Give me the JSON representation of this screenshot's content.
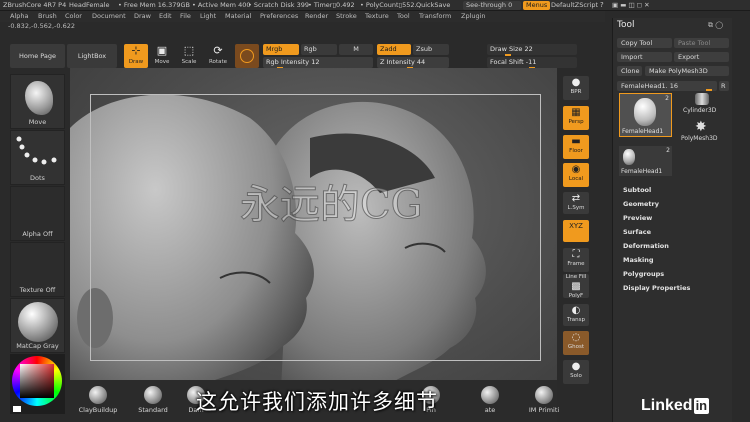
{
  "titlebar": {
    "app": "ZBrushCore 4R7 P4",
    "doc": "HeadFemale",
    "free_mem": "• Free Mem 16.379GB",
    "active_mem": "• Active Mem 400",
    "scratch": "• Scratch Disk 399",
    "timer": "• Timer▯0.492",
    "polycount": "• PolyCount▯552.",
    "quicksave": "QuickSave",
    "see_through": "See-through 0",
    "menus": "Menus",
    "default_script": "DefaultZScript"
  },
  "menubar": [
    "Alpha",
    "Brush",
    "Color",
    "Document",
    "Draw",
    "Edit",
    "File",
    "Light",
    "Material",
    "Preferences",
    "Render",
    "Stroke",
    "Texture",
    "Tool",
    "Transform",
    "Zplugin"
  ],
  "coords": "-0.832,-0.562,-0.622",
  "toolbar": {
    "home_page": "Home Page",
    "lightbox": "LightBox",
    "draw": "Draw",
    "move": "Move",
    "scale": "Scale",
    "rotate": "Rotate",
    "mrgb": "Mrgb",
    "rgb": "Rgb",
    "m": "M",
    "zadd": "Zadd",
    "zsub": "Zsub",
    "rgb_intensity": "Rgb Intensity 12",
    "z_intensity": "Z Intensity 44",
    "draw_size": "Draw Size 22",
    "focal_shift": "Focal Shift -11"
  },
  "shelf": {
    "move": "Move",
    "dots": "Dots",
    "alpha_off": "Alpha Off",
    "texture_off": "Texture Off",
    "matcap": "MatCap Gray"
  },
  "right_icons": {
    "bpr": "BPR",
    "persp": "Persp",
    "floor": "Floor",
    "local": "Local",
    "lsym": "L.Sym",
    "xyz": "XYZ",
    "frame": "Frame",
    "linefill": "Line Fill",
    "polyf": "PolyF",
    "transp": "Transp",
    "ghost": "Ghost",
    "solo": "Solo"
  },
  "panel": {
    "title": "Tool",
    "copy_tool": "Copy Tool",
    "paste_tool": "Paste Tool",
    "import": "Import",
    "export": "Export",
    "clone": "Clone",
    "make_polymesh": "Make PolyMesh3D",
    "current_tool": "FemaleHead1. 16",
    "r": "R",
    "thumb_count_a": "2",
    "thumb_count_b": "2",
    "thumbs": [
      "FemaleHead1",
      "Cylinder3D",
      "PolyMesh3D",
      "FemaleHead1"
    ],
    "items": [
      "Subtool",
      "Geometry",
      "Preview",
      "Surface",
      "Deformation",
      "Masking",
      "Polygroups",
      "Display Properties"
    ]
  },
  "bottom": {
    "brushes": [
      "ClayBuildup",
      "Standard",
      "Dam",
      "Pin",
      "ate",
      "IM Primiti"
    ]
  },
  "subtitle": "这允许我们添加许多细节",
  "watermark": "永远的CG",
  "logo": {
    "linked": "Linked",
    "in": "in"
  },
  "colors": {
    "accent": "#f09a1e",
    "bg": "#2a2a2a"
  }
}
